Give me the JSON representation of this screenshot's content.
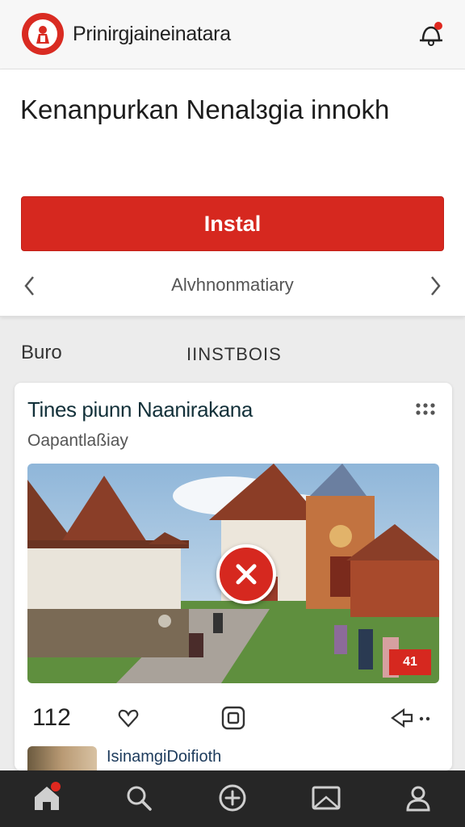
{
  "header": {
    "app_title": "Prinirgjaineinatara",
    "logo_icon": "emblem-icon",
    "notification_icon": "bell-icon"
  },
  "promo": {
    "title": "Kenanpurkan Nenalɜgia innokh",
    "install_label": "Instal",
    "carousel_label": "Alvhnonmatiary"
  },
  "tabs": [
    {
      "label": "Buro"
    },
    {
      "label": "IINSTBOIS"
    }
  ],
  "post": {
    "title": "Tines piunn Naanirakana",
    "subtitle": "Oapantlaßiay",
    "badge": "41",
    "count": "112",
    "next_user": "IsinamgiDoifioth"
  },
  "colors": {
    "brand_red": "#d6281f",
    "nav_bg": "#262626"
  }
}
